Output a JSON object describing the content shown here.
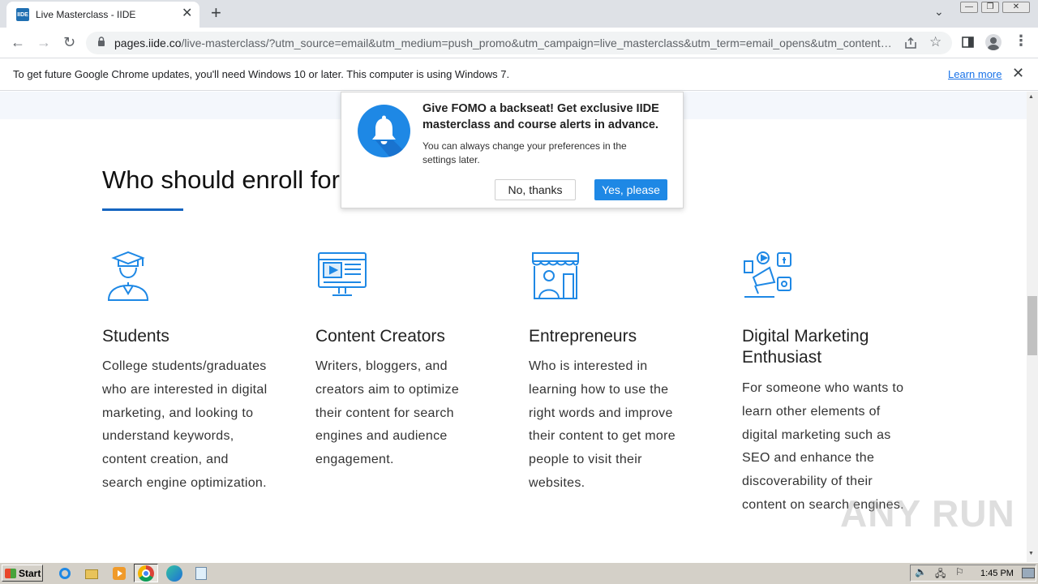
{
  "browser": {
    "tab_title": "Live Masterclass - IIDE",
    "tab_favicon_text": "IIDE",
    "url_host": "pages.iide.co",
    "url_path": "/live-masterclass/?utm_source=email&utm_medium=push_promo&utm_campaign=live_masterclass&utm_term=email_opens&utm_content=...",
    "infobar_text": "To get future Google Chrome updates, you'll need Windows 10 or later. This computer is using Windows 7.",
    "infobar_link": "Learn more"
  },
  "page": {
    "section_heading": "Who should enroll for",
    "columns": [
      {
        "icon": "graduate-icon",
        "title": "Students",
        "description": "College students/graduates who are interested in digital marketing, and looking to understand keywords, content creation, and search engine optimization."
      },
      {
        "icon": "video-monitor-icon",
        "title": "Content Creators",
        "description": "Writers, bloggers, and creators aim to optimize their content for search engines and audience engagement."
      },
      {
        "icon": "shop-owner-icon",
        "title": "Entrepreneurs",
        "description": "Who is interested in learning how to use the right words and improve their content to get more people to visit their websites."
      },
      {
        "icon": "megaphone-social-icon",
        "title": "Digital Marketing Enthusiast",
        "description": "For someone who wants to learn other elements of digital marketing such as SEO and enhance the discoverability of their content on search engines."
      }
    ]
  },
  "popup": {
    "title": "Give FOMO a backseat! Get exclusive IIDE masterclass and course alerts in advance.",
    "subtitle": "You can always change your preferences in the settings later.",
    "no_label": "No, thanks",
    "yes_label": "Yes, please",
    "accent_color": "#1e88e5"
  },
  "taskbar": {
    "start_label": "Start",
    "clock": "1:45 PM"
  },
  "watermark": "ANY RUN"
}
